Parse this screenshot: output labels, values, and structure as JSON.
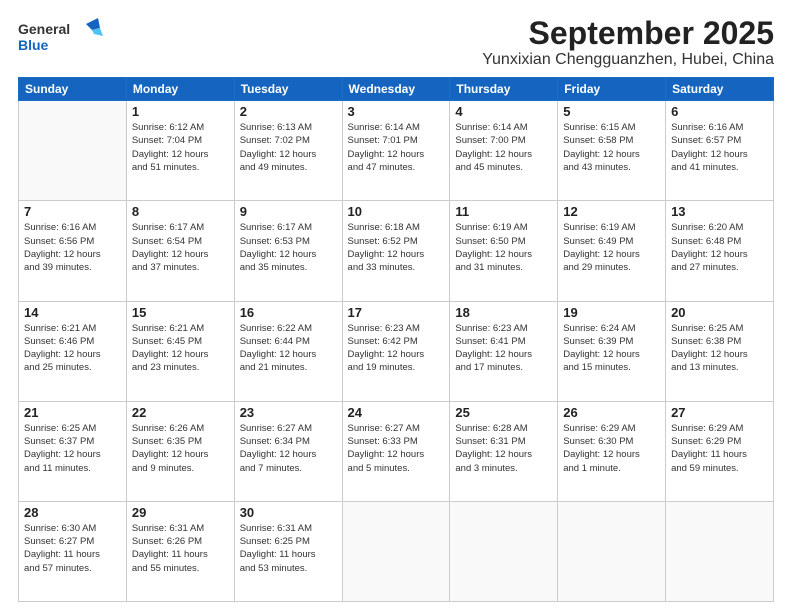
{
  "logo": {
    "line1": "General",
    "line2": "Blue"
  },
  "title": "September 2025",
  "subtitle": "Yunxixian Chengguanzhen, Hubei, China",
  "days_of_week": [
    "Sunday",
    "Monday",
    "Tuesday",
    "Wednesday",
    "Thursday",
    "Friday",
    "Saturday"
  ],
  "weeks": [
    [
      {
        "day": "",
        "info": ""
      },
      {
        "day": "1",
        "info": "Sunrise: 6:12 AM\nSunset: 7:04 PM\nDaylight: 12 hours\nand 51 minutes."
      },
      {
        "day": "2",
        "info": "Sunrise: 6:13 AM\nSunset: 7:02 PM\nDaylight: 12 hours\nand 49 minutes."
      },
      {
        "day": "3",
        "info": "Sunrise: 6:14 AM\nSunset: 7:01 PM\nDaylight: 12 hours\nand 47 minutes."
      },
      {
        "day": "4",
        "info": "Sunrise: 6:14 AM\nSunset: 7:00 PM\nDaylight: 12 hours\nand 45 minutes."
      },
      {
        "day": "5",
        "info": "Sunrise: 6:15 AM\nSunset: 6:58 PM\nDaylight: 12 hours\nand 43 minutes."
      },
      {
        "day": "6",
        "info": "Sunrise: 6:16 AM\nSunset: 6:57 PM\nDaylight: 12 hours\nand 41 minutes."
      }
    ],
    [
      {
        "day": "7",
        "info": "Sunrise: 6:16 AM\nSunset: 6:56 PM\nDaylight: 12 hours\nand 39 minutes."
      },
      {
        "day": "8",
        "info": "Sunrise: 6:17 AM\nSunset: 6:54 PM\nDaylight: 12 hours\nand 37 minutes."
      },
      {
        "day": "9",
        "info": "Sunrise: 6:17 AM\nSunset: 6:53 PM\nDaylight: 12 hours\nand 35 minutes."
      },
      {
        "day": "10",
        "info": "Sunrise: 6:18 AM\nSunset: 6:52 PM\nDaylight: 12 hours\nand 33 minutes."
      },
      {
        "day": "11",
        "info": "Sunrise: 6:19 AM\nSunset: 6:50 PM\nDaylight: 12 hours\nand 31 minutes."
      },
      {
        "day": "12",
        "info": "Sunrise: 6:19 AM\nSunset: 6:49 PM\nDaylight: 12 hours\nand 29 minutes."
      },
      {
        "day": "13",
        "info": "Sunrise: 6:20 AM\nSunset: 6:48 PM\nDaylight: 12 hours\nand 27 minutes."
      }
    ],
    [
      {
        "day": "14",
        "info": "Sunrise: 6:21 AM\nSunset: 6:46 PM\nDaylight: 12 hours\nand 25 minutes."
      },
      {
        "day": "15",
        "info": "Sunrise: 6:21 AM\nSunset: 6:45 PM\nDaylight: 12 hours\nand 23 minutes."
      },
      {
        "day": "16",
        "info": "Sunrise: 6:22 AM\nSunset: 6:44 PM\nDaylight: 12 hours\nand 21 minutes."
      },
      {
        "day": "17",
        "info": "Sunrise: 6:23 AM\nSunset: 6:42 PM\nDaylight: 12 hours\nand 19 minutes."
      },
      {
        "day": "18",
        "info": "Sunrise: 6:23 AM\nSunset: 6:41 PM\nDaylight: 12 hours\nand 17 minutes."
      },
      {
        "day": "19",
        "info": "Sunrise: 6:24 AM\nSunset: 6:39 PM\nDaylight: 12 hours\nand 15 minutes."
      },
      {
        "day": "20",
        "info": "Sunrise: 6:25 AM\nSunset: 6:38 PM\nDaylight: 12 hours\nand 13 minutes."
      }
    ],
    [
      {
        "day": "21",
        "info": "Sunrise: 6:25 AM\nSunset: 6:37 PM\nDaylight: 12 hours\nand 11 minutes."
      },
      {
        "day": "22",
        "info": "Sunrise: 6:26 AM\nSunset: 6:35 PM\nDaylight: 12 hours\nand 9 minutes."
      },
      {
        "day": "23",
        "info": "Sunrise: 6:27 AM\nSunset: 6:34 PM\nDaylight: 12 hours\nand 7 minutes."
      },
      {
        "day": "24",
        "info": "Sunrise: 6:27 AM\nSunset: 6:33 PM\nDaylight: 12 hours\nand 5 minutes."
      },
      {
        "day": "25",
        "info": "Sunrise: 6:28 AM\nSunset: 6:31 PM\nDaylight: 12 hours\nand 3 minutes."
      },
      {
        "day": "26",
        "info": "Sunrise: 6:29 AM\nSunset: 6:30 PM\nDaylight: 12 hours\nand 1 minute."
      },
      {
        "day": "27",
        "info": "Sunrise: 6:29 AM\nSunset: 6:29 PM\nDaylight: 11 hours\nand 59 minutes."
      }
    ],
    [
      {
        "day": "28",
        "info": "Sunrise: 6:30 AM\nSunset: 6:27 PM\nDaylight: 11 hours\nand 57 minutes."
      },
      {
        "day": "29",
        "info": "Sunrise: 6:31 AM\nSunset: 6:26 PM\nDaylight: 11 hours\nand 55 minutes."
      },
      {
        "day": "30",
        "info": "Sunrise: 6:31 AM\nSunset: 6:25 PM\nDaylight: 11 hours\nand 53 minutes."
      },
      {
        "day": "",
        "info": ""
      },
      {
        "day": "",
        "info": ""
      },
      {
        "day": "",
        "info": ""
      },
      {
        "day": "",
        "info": ""
      }
    ]
  ]
}
